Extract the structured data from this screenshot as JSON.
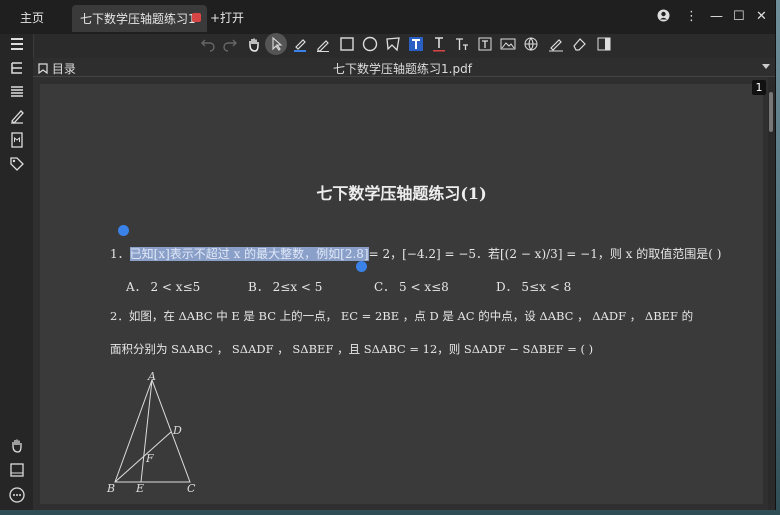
{
  "tabs": {
    "home": "主页",
    "doc": "七下数学压轴题练习1",
    "open": "+打开"
  },
  "header": {
    "toc": "目录",
    "filename": "七下数学压轴题练习1.pdf"
  },
  "page_number": "1",
  "document": {
    "title": "七下数学压轴题练习(1)",
    "q1_highlight": "已知[x]表示不超过 x 的最大整数，例如[2.8]",
    "q1_rest": "= 2，[−4.2] = −5．若[(2 − x)/3] = −1，则 x 的取值范围是(        )",
    "q1_num": "1．",
    "q1_options": [
      "A． 2 < x≤5",
      "B． 2≤x < 5",
      "C． 5 < x≤8",
      "D． 5≤x < 8"
    ],
    "q2_line1": "2．如图，在 ΔABC 中 E 是 BC 上的一点， EC = 2BE ，点 D 是 AC 的中点，设 ΔABC ， ΔADF ， ΔBEF 的",
    "q2_line2": "面积分别为 SΔABC ， SΔADF ， SΔBEF ，且 SΔABC = 12，则 SΔADF − SΔBEF = (        )",
    "figure_labels": {
      "A": "A",
      "B": "B",
      "C": "C",
      "D": "D",
      "E": "E",
      "F": "F"
    }
  }
}
